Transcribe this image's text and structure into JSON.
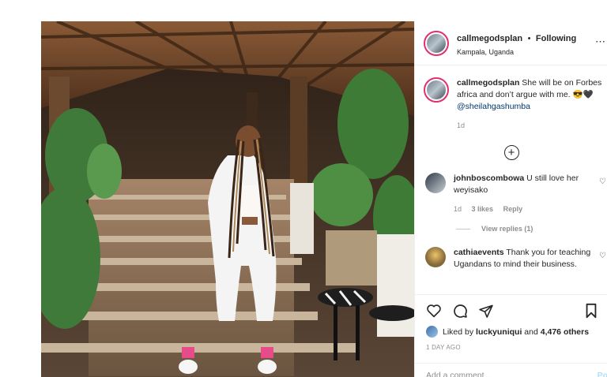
{
  "post": {
    "username": "callmegodsplan",
    "follow_separator": "•",
    "follow_label": "Following",
    "location": "Kampala, Uganda",
    "more_glyph": "⋯"
  },
  "caption": {
    "username": "callmegodsplan",
    "text": "She will be on Forbes africa and don’t argue with me. 😎🖤",
    "mention": "@sheilahgashumba",
    "age": "1d"
  },
  "load_more_glyph": "+",
  "comments": [
    {
      "username": "johnboscombowa",
      "text": "U still love her weyisako",
      "age": "1d",
      "likes": "3 likes",
      "reply_label": "Reply",
      "view_replies": "View replies (1)"
    },
    {
      "username": "cathiaevents",
      "text": "Thank you for teaching Ugandans to mind their business."
    }
  ],
  "actions": {
    "icons": [
      "heart-icon",
      "comment-icon",
      "share-icon",
      "bookmark-icon"
    ]
  },
  "likes": {
    "prefix": "Liked by",
    "user": "luckyuniqui",
    "and": "and",
    "others": "4,476 others"
  },
  "date": "1 DAY AGO",
  "add_comment": {
    "placeholder": "Add a comment...",
    "post_label": "Po"
  },
  "colors": {
    "story_ring": "#e1306c",
    "post_button": "#b2dffc",
    "mention": "#00376b",
    "muted": "#8e8e8e"
  }
}
